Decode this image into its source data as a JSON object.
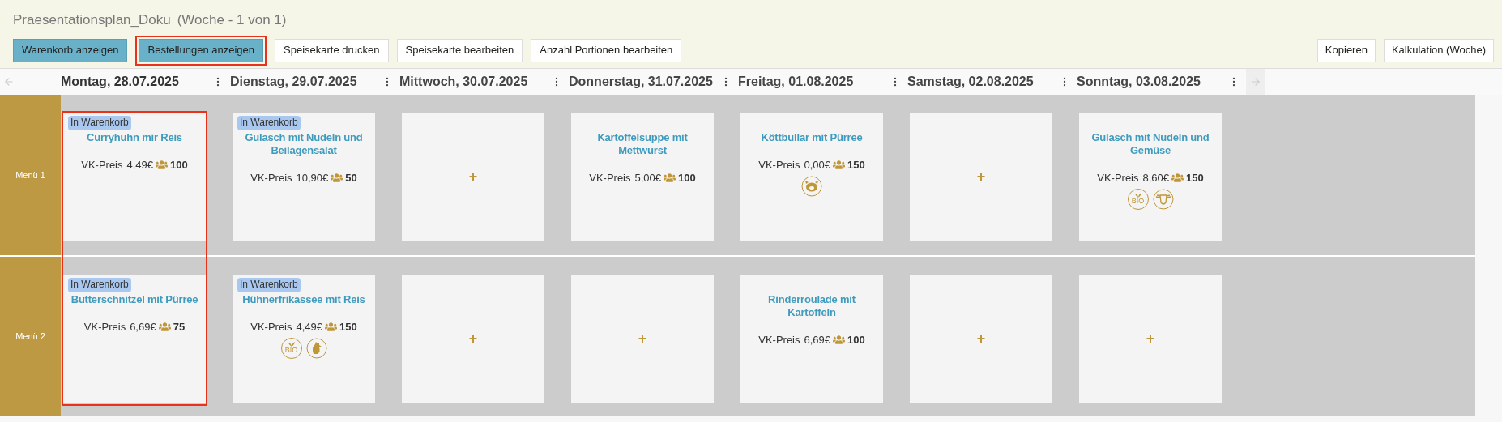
{
  "title": "Praesentationsplan_Doku",
  "subtitle": "(Woche - 1 von 1)",
  "toolbar_left": [
    {
      "label": "Warenkorb anzeigen",
      "kind": "primary",
      "highlighted": false
    },
    {
      "label": "Bestellungen anzeigen",
      "kind": "primary",
      "highlighted": true
    },
    {
      "label": "Speisekarte drucken",
      "kind": "default",
      "highlighted": false
    },
    {
      "label": "Speisekarte bearbeiten",
      "kind": "default",
      "highlighted": false
    },
    {
      "label": "Anzahl Portionen bearbeiten",
      "kind": "default",
      "highlighted": false
    }
  ],
  "toolbar_right": [
    {
      "label": "Kopieren"
    },
    {
      "label": "Kalkulation (Woche)"
    }
  ],
  "days": [
    {
      "label": "Montag, 28.07.2025",
      "highlighted": true
    },
    {
      "label": "Dienstag, 29.07.2025",
      "highlighted": false
    },
    {
      "label": "Mittwoch, 30.07.2025",
      "highlighted": false
    },
    {
      "label": "Donnerstag, 31.07.2025",
      "highlighted": false
    },
    {
      "label": "Freitag, 01.08.2025",
      "highlighted": false
    },
    {
      "label": "Samstag, 02.08.2025",
      "highlighted": false
    },
    {
      "label": "Sonntag, 03.08.2025",
      "highlighted": false
    }
  ],
  "menus": [
    {
      "label": "Menü 1",
      "cells": [
        {
          "kind": "dish",
          "badge": "In Warenkorb",
          "name": "Curryhuhn mir Reis",
          "price_label": "VK-Preis",
          "price": "4,49€",
          "portions": "100"
        },
        {
          "kind": "dish",
          "badge": "In Warenkorb",
          "name": "Gulasch mit Nudeln und Beilagensalat",
          "price_label": "VK-Preis",
          "price": "10,90€",
          "portions": "50"
        },
        {
          "kind": "empty",
          "add": "+"
        },
        {
          "kind": "dish",
          "name": "Kartoffelsuppe mit Mettwurst",
          "price_label": "VK-Preis",
          "price": "5,00€",
          "portions": "100"
        },
        {
          "kind": "dish",
          "name": "Köttbullar mit Pürree",
          "price_label": "VK-Preis",
          "price": "0,00€",
          "portions": "150",
          "tags": [
            {
              "kind": "pig"
            }
          ]
        },
        {
          "kind": "empty",
          "add": "+"
        },
        {
          "kind": "dish",
          "name": "Gulasch mit Nudeln und Gemüse",
          "price_label": "VK-Preis",
          "price": "8,60€",
          "portions": "150",
          "tags": [
            {
              "kind": "bio",
              "label": "BIO"
            },
            {
              "kind": "cow"
            }
          ]
        }
      ]
    },
    {
      "label": "Menü 2",
      "cells": [
        {
          "kind": "dish",
          "badge": "In Warenkorb",
          "name": "Butterschnitzel mit Pürree",
          "price_label": "VK-Preis",
          "price": "6,69€",
          "portions": "75"
        },
        {
          "kind": "dish",
          "badge": "In Warenkorb",
          "name": "Hühnerfrikassee mit Reis",
          "price_label": "VK-Preis",
          "price": "4,49€",
          "portions": "150",
          "tags": [
            {
              "kind": "bio",
              "label": "BIO"
            },
            {
              "kind": "chicken"
            }
          ]
        },
        {
          "kind": "empty",
          "add": "+"
        },
        {
          "kind": "empty",
          "add": "+"
        },
        {
          "kind": "dish",
          "name": "Rinderroulade mit Kartoffeln",
          "price_label": "VK-Preis",
          "price": "6,69€",
          "portions": "100"
        },
        {
          "kind": "empty",
          "add": "+"
        },
        {
          "kind": "empty",
          "add": "+"
        }
      ]
    }
  ]
}
